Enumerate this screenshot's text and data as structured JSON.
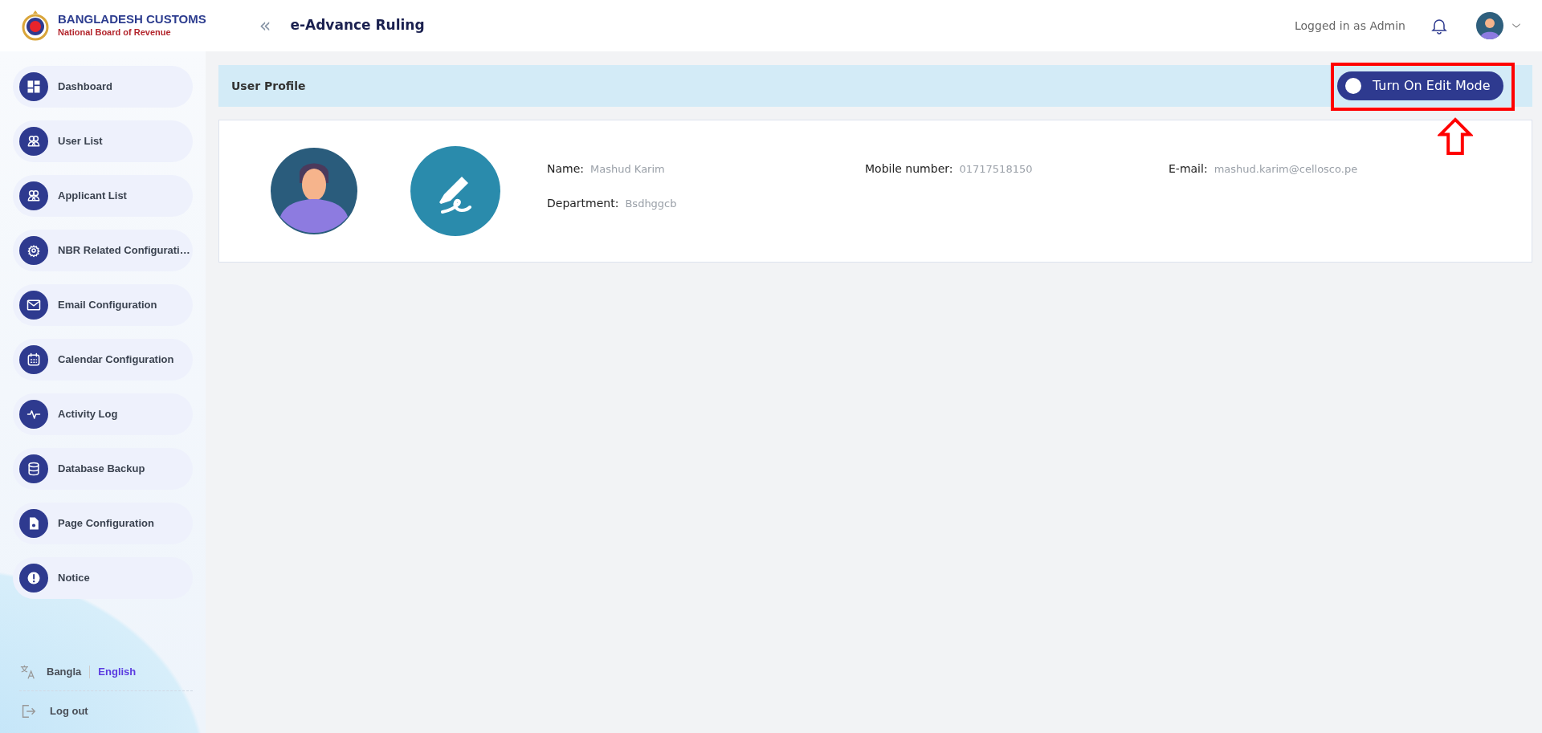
{
  "header": {
    "logo_title": "BANGLADESH CUSTOMS",
    "logo_subtitle": "National Board of Revenue",
    "collapse_glyph": "«",
    "app_title": "e-Advance Ruling",
    "logged_in": "Logged in as Admin"
  },
  "sidebar": {
    "items": [
      {
        "label": "Dashboard"
      },
      {
        "label": "User List"
      },
      {
        "label": "Applicant List"
      },
      {
        "label": "NBR Related Configurati…"
      },
      {
        "label": "Email Configuration"
      },
      {
        "label": "Calendar Configuration"
      },
      {
        "label": "Activity Log"
      },
      {
        "label": "Database Backup"
      },
      {
        "label": "Page Configuration"
      },
      {
        "label": "Notice"
      }
    ],
    "languages": [
      {
        "label": "Bangla",
        "selected": false
      },
      {
        "label": "English",
        "selected": true
      }
    ],
    "logout": "Log out"
  },
  "page": {
    "title": "User Profile",
    "edit_toggle": {
      "label": "Turn On Edit Mode",
      "on": false
    }
  },
  "profile": {
    "fields": [
      {
        "label": "Name:",
        "value": "Mashud Karim"
      },
      {
        "label": "Mobile number:",
        "value": "01717518150"
      },
      {
        "label": "E-mail:",
        "value": "mashud.karim@cellosco.pe"
      },
      {
        "label": "Department:",
        "value": "Bsdhggcb"
      }
    ]
  }
}
